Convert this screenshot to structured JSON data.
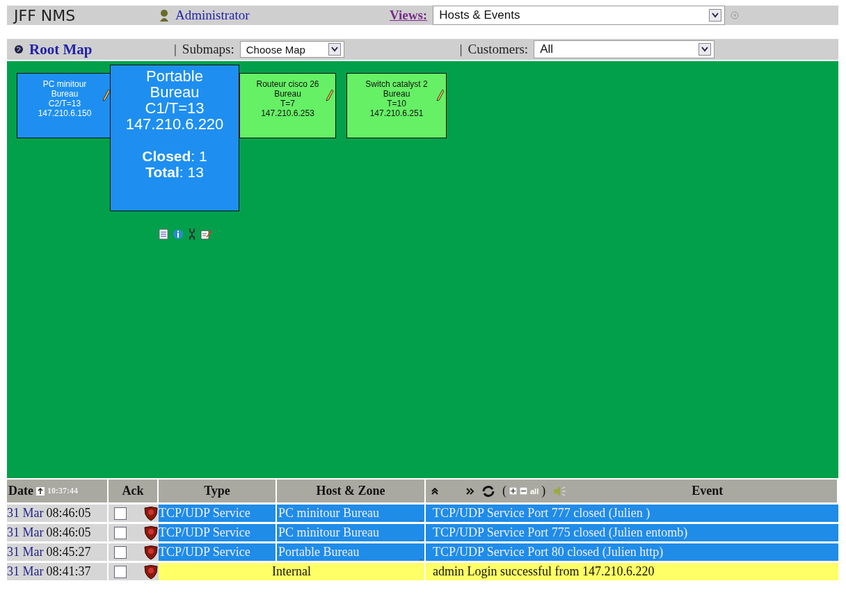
{
  "header": {
    "app_title": "JFF NMS",
    "user": "Administrator",
    "views_label": "Views:",
    "views_value": "Hosts & Events"
  },
  "toolbar": {
    "root_map": "Root Map",
    "submaps_separator": "|",
    "submaps_label": "Submaps:",
    "submaps_value": "Choose Map",
    "customers_separator": "|",
    "customers_label": "Customers:",
    "customers_value": "All"
  },
  "map": {
    "nodes": [
      {
        "lines": [
          "PC minitour",
          "Bureau",
          "C2/T=13",
          "147.210.6.150"
        ],
        "color": "#1e8ff0"
      },
      {
        "lines": [
          "Routeur cisco 26",
          "Bureau",
          "T=7",
          "147.210.6.253"
        ],
        "color": "#66f066"
      },
      {
        "lines": [
          "Switch catalyst 2",
          "Bureau",
          "T=10",
          "147.210.6.251"
        ],
        "color": "#66f066"
      }
    ],
    "popup": {
      "lines": [
        "Portable",
        "Bureau",
        "C1/T=13",
        "147.210.6.220"
      ],
      "stats": [
        "**Closed**: 1",
        "**Total**: 13"
      ],
      "color": "#1e8ff0"
    }
  },
  "events": {
    "columns": {
      "date": "Date",
      "clock": "10:37:44",
      "ack": "Ack",
      "type": "Type",
      "host": "Host & Zone",
      "event": "Event",
      "open_paren": "(",
      "all": "all",
      "close_paren": ")"
    },
    "rows": [
      {
        "kind": "event",
        "day": "31 Mar",
        "time": "08:46:05",
        "checked": false,
        "type": "TCP/UDP Service",
        "host": "PC minitour Bureau",
        "event": "TCP/UDP Service Port 777 closed (Julien )"
      },
      {
        "kind": "event",
        "day": "31 Mar",
        "time": "08:46:05",
        "checked": false,
        "type": "TCP/UDP Service",
        "host": "PC minitour Bureau",
        "event": "TCP/UDP Service Port 775 closed (Julien entomb)"
      },
      {
        "kind": "event",
        "day": "31 Mar",
        "time": "08:45:27",
        "checked": false,
        "type": "TCP/UDP Service",
        "host": "Portable Bureau",
        "event": "TCP/UDP Service Port 80 closed (Julien http)"
      },
      {
        "kind": "internal",
        "day": "31 Mar",
        "time": "08:41:37",
        "checked": false,
        "type": "Internal",
        "event": "admin Login successful from 147.210.6.220"
      }
    ]
  }
}
